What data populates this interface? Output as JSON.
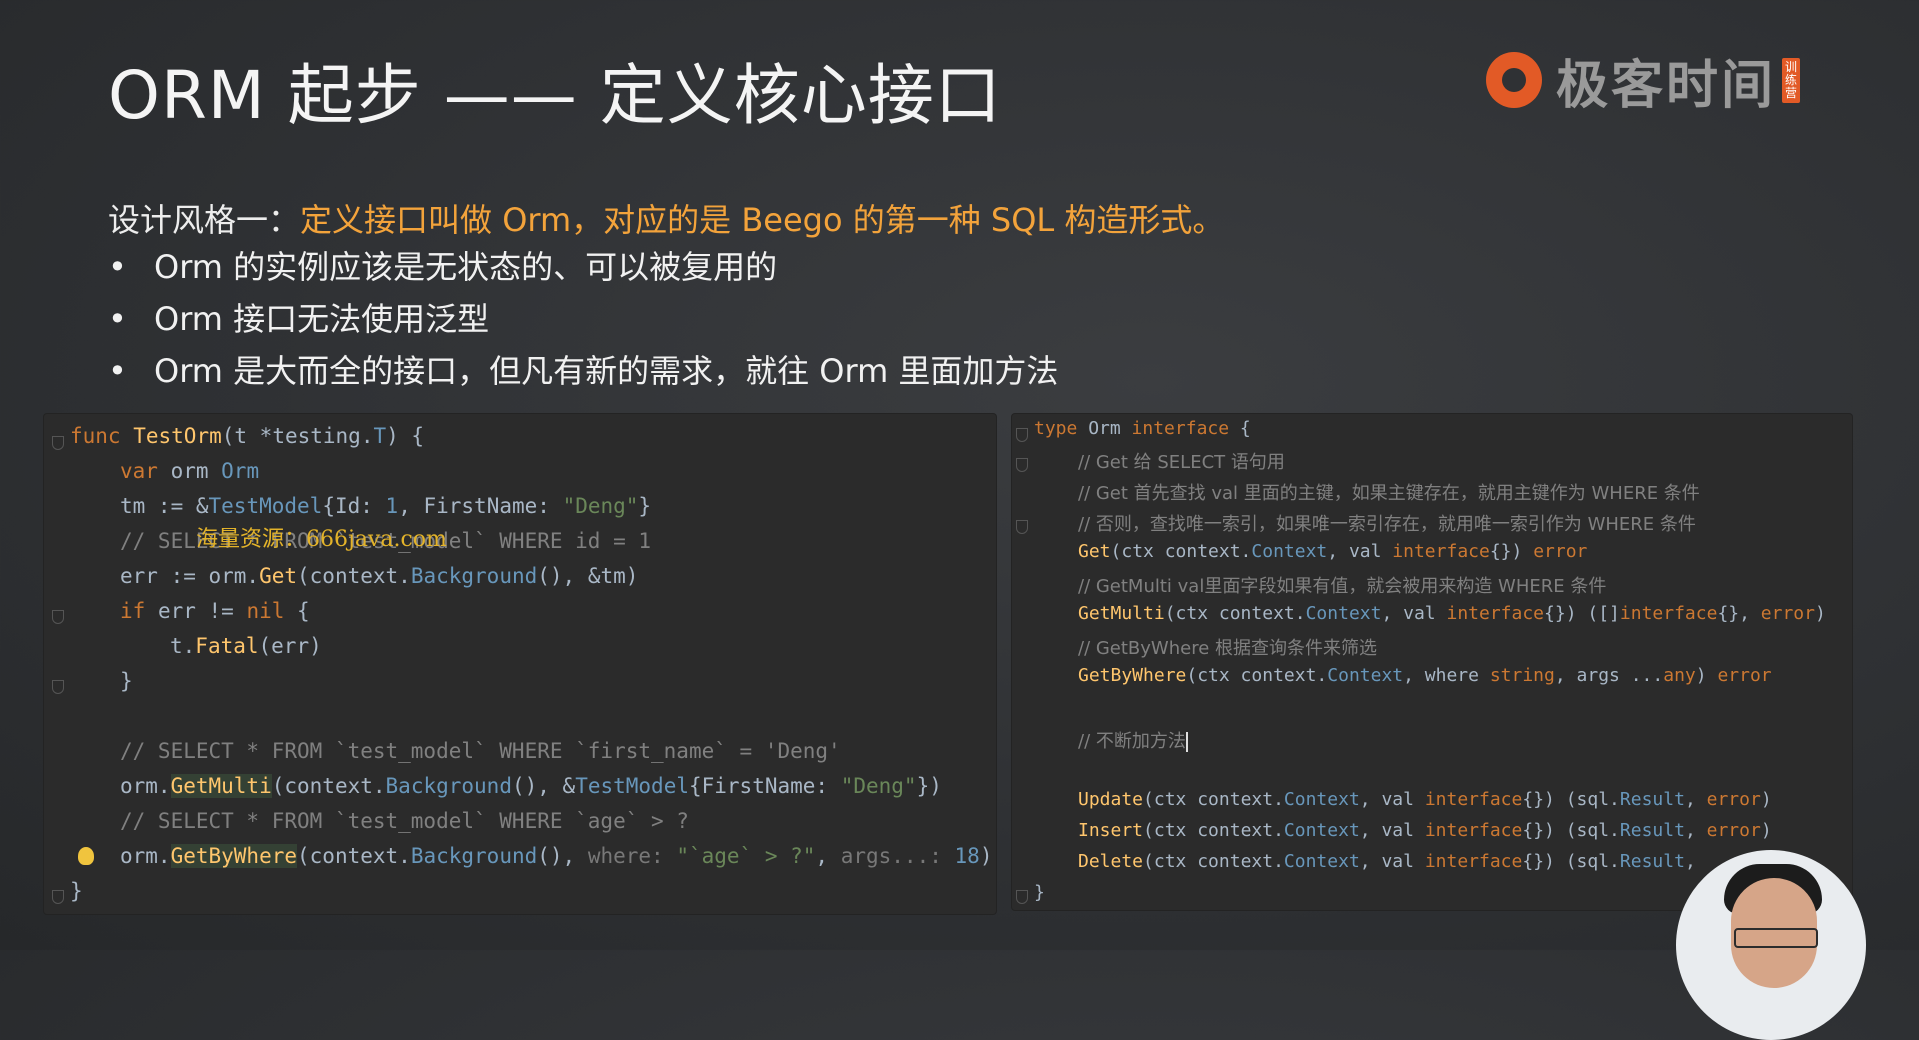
{
  "slide": {
    "title": "ORM 起步 —— 定义核心接口",
    "brand": {
      "name": "极客时间",
      "tag": "训练营",
      "accent": "#e25a26"
    },
    "lead_prefix": "设计风格一：",
    "lead_highlight": "定义接口叫做 Orm，对应的是 Beego 的第一种 SQL 构造形式。",
    "bullets": [
      "Orm 的实例应该是无状态的、可以被复用的",
      "Orm 接口无法使用泛型",
      "Orm 是大而全的接口，但凡有新的需求，就往 Orm 里面加方法"
    ],
    "watermark": "海量资源：666java.com"
  },
  "left_code": {
    "l1": [
      "func",
      "TestOrm",
      "(t *testing.",
      "T",
      ") {"
    ],
    "l2": [
      "var",
      " orm ",
      "Orm"
    ],
    "l3": [
      "tm := &",
      "TestModel",
      "{Id: ",
      "1",
      ", FirstName: ",
      "\"Deng\"",
      "}"
    ],
    "l4": "// SELECT * FROM `test_model` WHERE id = 1",
    "l5": [
      "err := orm.",
      "Get",
      "(context.",
      "Background",
      "(), &tm)"
    ],
    "l6": [
      "if",
      " err != ",
      "nil",
      " {"
    ],
    "l7": [
      "t.",
      "Fatal",
      "(err)"
    ],
    "l8": "}",
    "l10": "// SELECT * FROM `test_model` WHERE `first_name` = 'Deng'",
    "l11": [
      "orm.",
      "GetMulti",
      "(context.",
      "Background",
      "(), &",
      "TestModel",
      "{FirstName: ",
      "\"Deng\"",
      "})"
    ],
    "l12": "// SELECT * FROM `test_model` WHERE `age` > ?",
    "l13": [
      "orm.",
      "GetByWhere",
      "(context.",
      "Background",
      "(), ",
      "where: ",
      "\"`age` > ?\"",
      ", ",
      "args...: ",
      "18",
      ")"
    ],
    "l14": "}"
  },
  "right_code": {
    "r1": [
      "type",
      " Orm ",
      "interface",
      " {"
    ],
    "r2": "// Get 给 SELECT 语句用",
    "r3": "// Get 首先查找 val 里面的主键，如果主键存在，就用主键作为 WHERE 条件",
    "r4": "// 否则，查找唯一索引，如果唯一索引存在，就用唯一索引作为 WHERE 条件",
    "r5": [
      "Get",
      "(ctx context.",
      "Context",
      ", val ",
      "interface",
      "{}) ",
      "error"
    ],
    "r6": "// GetMulti val里面字段如果有值，就会被用来构造 WHERE 条件",
    "r7": [
      "GetMulti",
      "(ctx context.",
      "Context",
      ", val ",
      "interface",
      "{}) ([]",
      "interface",
      "{}, ",
      "error",
      ")"
    ],
    "r8": "// GetByWhere 根据查询条件来筛选",
    "r9": [
      "GetByWhere",
      "(ctx context.",
      "Context",
      ", where ",
      "string",
      ", args ...",
      "any",
      ") ",
      "error"
    ],
    "r11": "// 不断加方法",
    "r13": [
      "Update",
      "(ctx context.",
      "Context",
      ", val ",
      "interface",
      "{}) (sql.",
      "Result",
      ", ",
      "error",
      ")"
    ],
    "r14": [
      "Insert",
      "(ctx context.",
      "Context",
      ", val ",
      "interface",
      "{}) (sql.",
      "Result",
      ", ",
      "error",
      ")"
    ],
    "r15": [
      "Delete",
      "(ctx context.",
      "Context",
      ", val ",
      "interface",
      "{}) (sql.",
      "Result",
      ", "
    ],
    "r16": "}"
  }
}
